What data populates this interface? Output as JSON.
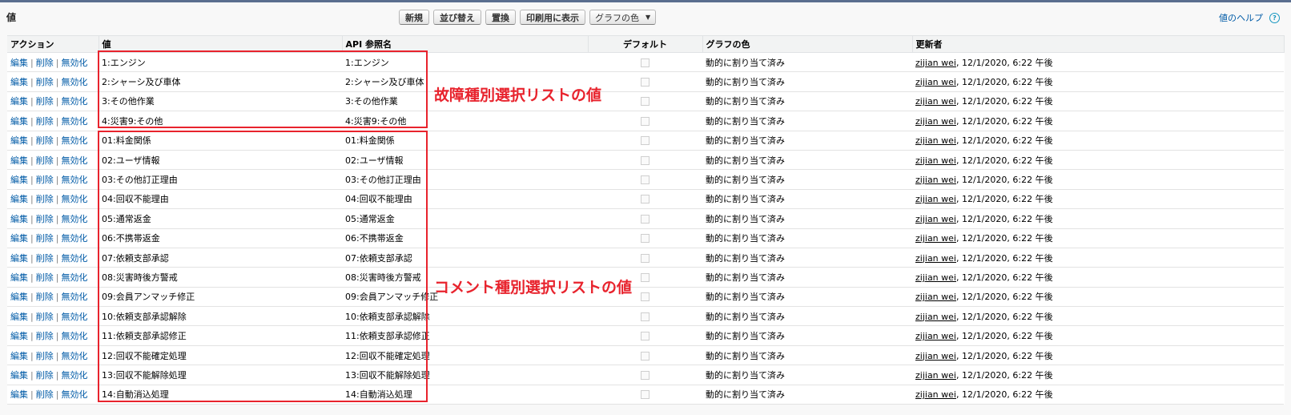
{
  "page": {
    "title": "値",
    "help_link": "値のヘルプ",
    "help_icon": "?"
  },
  "toolbar": {
    "buttons": [
      "新規",
      "並び替え",
      "置換",
      "印刷用に表示"
    ],
    "chart_color_select": "グラフの色"
  },
  "table": {
    "headers": [
      "アクション",
      "値",
      "API 参照名",
      "デフォルト",
      "グラフの色",
      "更新者"
    ],
    "actions": [
      "編集",
      "削除",
      "無効化"
    ],
    "rows": [
      {
        "value": "1:エンジン",
        "api": "1:エンジン",
        "color": "動的に割り当て済み",
        "user": "zijian wei",
        "date": ", 12/1/2020, 6:22 午後"
      },
      {
        "value": "2:シャーシ及び車体",
        "api": "2:シャーシ及び車体",
        "color": "動的に割り当て済み",
        "user": "zijian wei",
        "date": ", 12/1/2020, 6:22 午後"
      },
      {
        "value": "3:その他作業",
        "api": "3:その他作業",
        "color": "動的に割り当て済み",
        "user": "zijian wei",
        "date": ", 12/1/2020, 6:22 午後"
      },
      {
        "value": "4:災害9:その他",
        "api": "4:災害9:その他",
        "color": "動的に割り当て済み",
        "user": "zijian wei",
        "date": ", 12/1/2020, 6:22 午後"
      },
      {
        "value": "01:料金関係",
        "api": "01:料金関係",
        "color": "動的に割り当て済み",
        "user": "zijian wei",
        "date": ", 12/1/2020, 6:22 午後"
      },
      {
        "value": "02:ユーザ情報",
        "api": "02:ユーザ情報",
        "color": "動的に割り当て済み",
        "user": "zijian wei",
        "date": ", 12/1/2020, 6:22 午後"
      },
      {
        "value": "03:その他訂正理由",
        "api": "03:その他訂正理由",
        "color": "動的に割り当て済み",
        "user": "zijian wei",
        "date": ", 12/1/2020, 6:22 午後"
      },
      {
        "value": "04:回収不能理由",
        "api": "04:回収不能理由",
        "color": "動的に割り当て済み",
        "user": "zijian wei",
        "date": ", 12/1/2020, 6:22 午後"
      },
      {
        "value": "05:通常返金",
        "api": "05:通常返金",
        "color": "動的に割り当て済み",
        "user": "zijian wei",
        "date": ", 12/1/2020, 6:22 午後"
      },
      {
        "value": "06:不携帯返金",
        "api": "06:不携帯返金",
        "color": "動的に割り当て済み",
        "user": "zijian wei",
        "date": ", 12/1/2020, 6:22 午後"
      },
      {
        "value": "07:依頼支部承認",
        "api": "07:依頼支部承認",
        "color": "動的に割り当て済み",
        "user": "zijian wei",
        "date": ", 12/1/2020, 6:22 午後"
      },
      {
        "value": "08:災害時後方警戒",
        "api": "08:災害時後方警戒",
        "color": "動的に割り当て済み",
        "user": "zijian wei",
        "date": ", 12/1/2020, 6:22 午後"
      },
      {
        "value": "09:会員アンマッチ修正",
        "api": "09:会員アンマッチ修正",
        "color": "動的に割り当て済み",
        "user": "zijian wei",
        "date": ", 12/1/2020, 6:22 午後"
      },
      {
        "value": "10:依頼支部承認解除",
        "api": "10:依頼支部承認解除",
        "color": "動的に割り当て済み",
        "user": "zijian wei",
        "date": ", 12/1/2020, 6:22 午後"
      },
      {
        "value": "11:依頼支部承認修正",
        "api": "11:依頼支部承認修正",
        "color": "動的に割り当て済み",
        "user": "zijian wei",
        "date": ", 12/1/2020, 6:22 午後"
      },
      {
        "value": "12:回収不能確定処理",
        "api": "12:回収不能確定処理",
        "color": "動的に割り当て済み",
        "user": "zijian wei",
        "date": ", 12/1/2020, 6:22 午後"
      },
      {
        "value": "13:回収不能解除処理",
        "api": "13:回収不能解除処理",
        "color": "動的に割り当て済み",
        "user": "zijian wei",
        "date": ", 12/1/2020, 6:22 午後"
      },
      {
        "value": "14:自動消込処理",
        "api": "14:自動消込処理",
        "color": "動的に割り当て済み",
        "user": "zijian wei",
        "date": ", 12/1/2020, 6:22 午後"
      }
    ]
  },
  "annotations": {
    "group1_label": "故障種別選択リストの値",
    "group2_label": "コメント種別選択リストの値",
    "color": "#e8232d"
  },
  "colors": {
    "link": "#015ba7",
    "header_border": "#5a6e8f"
  }
}
